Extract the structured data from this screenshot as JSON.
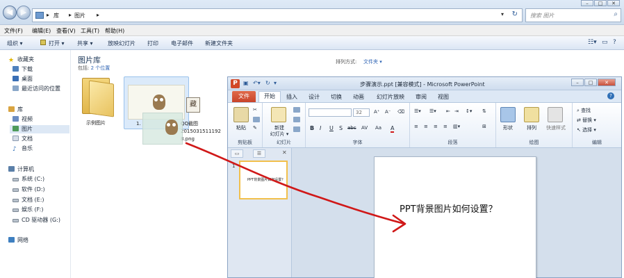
{
  "explorer": {
    "breadcrumb": [
      "库",
      "图片"
    ],
    "search_placeholder": "搜索 图片",
    "menu": [
      "文件(F)",
      "编辑(E)",
      "查看(V)",
      "工具(T)",
      "帮助(H)"
    ],
    "toolbar": [
      "组织 ▾",
      "打开 ▾",
      "共享 ▾",
      "放映幻灯片",
      "打印",
      "电子邮件",
      "新建文件夹"
    ],
    "sidebar": {
      "favorites_head": "收藏夹",
      "favorites": [
        "下载",
        "桌面",
        "最近访问的位置"
      ],
      "libraries_head": "库",
      "libraries": [
        "视频",
        "图片",
        "文档",
        "音乐"
      ],
      "computer_head": "计算机",
      "drives": [
        "系统 (C:)",
        "软件 (D:)",
        "文档 (E:)",
        "娱乐 (F:)",
        "CD 驱动器 (G:)"
      ],
      "network_head": "网络"
    },
    "library": {
      "title": "图片库",
      "subtitle_prefix": "包括: ",
      "subtitle_link": "2 个位置",
      "sort_label": "排列方式:",
      "sort_value": "文件夹 ▾"
    },
    "files": [
      {
        "label": "示例图片"
      },
      {
        "label": "1."
      },
      {
        "label_lines": [
          "QQ截图",
          "2015031511192",
          "8.png"
        ],
        "thumb_glyph": "藏"
      }
    ]
  },
  "ppt": {
    "title": "步骤演示.ppt [兼容模式] - Microsoft PowerPoint",
    "tabs": [
      "文件",
      "开始",
      "插入",
      "设计",
      "切换",
      "动画",
      "幻灯片放映",
      "审阅",
      "视图"
    ],
    "ribbon": {
      "clipboard": {
        "label": "剪贴板",
        "paste": "粘贴"
      },
      "slides": {
        "label": "幻灯片",
        "new_slide_lines": [
          "新建",
          "幻灯片 ▾"
        ]
      },
      "font": {
        "label": "字体",
        "size": "32",
        "buttons": [
          "B",
          "I",
          "U",
          "S",
          "abc",
          "AV",
          "Aa",
          "A"
        ]
      },
      "paragraph": {
        "label": "段落"
      },
      "drawing": {
        "label": "绘图",
        "shape": "形状",
        "arrange": "排列",
        "quick_styles": "快速样式"
      },
      "editing": {
        "label": "编辑",
        "items": [
          "查找",
          "替换 ▾",
          "选择 ▾"
        ]
      }
    },
    "thumb_pane": {
      "slide_number": "1",
      "thumb_text": "PPT背景图片如何设置？"
    },
    "slide": {
      "text": "PPT背景图片如何设置？"
    }
  },
  "colors": {
    "accent": "#2c62b3",
    "ppt_orange": "#d24726",
    "annotation_red": "#d01818"
  }
}
